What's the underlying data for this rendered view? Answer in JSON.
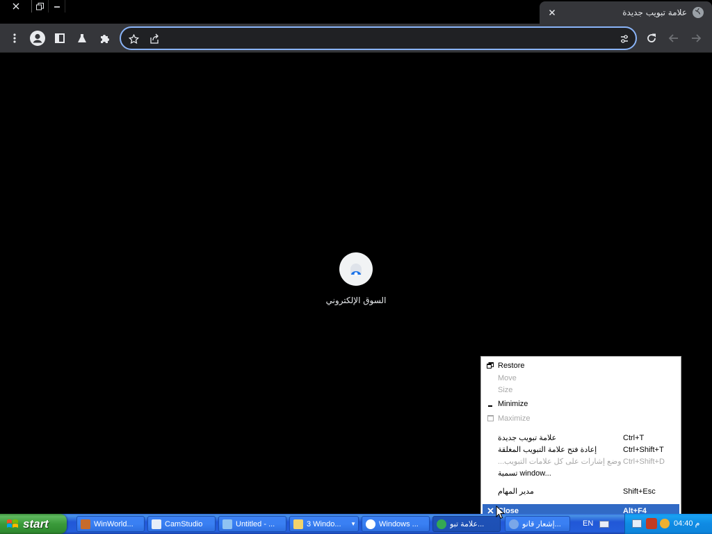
{
  "browser": {
    "tab": {
      "title": "علامة تبويب جديدة",
      "close_label": "✕"
    },
    "window_controls": {
      "close": "✕",
      "restore": "❐",
      "minimize": "—"
    },
    "omnibox": {
      "value": "",
      "placeholder": ""
    },
    "toolbar_icons": [
      "menu-dots-icon",
      "profile-icon",
      "side-panel-icon",
      "labs-flask-icon",
      "extensions-icon",
      "reload-icon",
      "back-icon",
      "forward-icon"
    ]
  },
  "content": {
    "shortcut": {
      "label": "السوق الإلكتروني"
    }
  },
  "context_menu": {
    "items": [
      {
        "label": "Restore",
        "shortcut": "",
        "enabled": true
      },
      {
        "label": "Move",
        "shortcut": "",
        "enabled": false
      },
      {
        "label": "Size",
        "shortcut": "",
        "enabled": false
      },
      {
        "label": "Minimize",
        "shortcut": "",
        "enabled": true
      },
      {
        "label": "Maximize",
        "shortcut": "",
        "enabled": false
      },
      {
        "label": "علامة تبويب جديدة",
        "shortcut": "Ctrl+T",
        "enabled": true
      },
      {
        "label": "إعادة فتح علامة التبويب المغلقة",
        "shortcut": "Ctrl+Shift+T",
        "enabled": true
      },
      {
        "label": "وضع إشارات على كل علامات التبويب...",
        "shortcut": "Ctrl+Shift+D",
        "enabled": false
      },
      {
        "label": "تسمية window...",
        "shortcut": "",
        "enabled": true
      },
      {
        "label": "مدير المهام",
        "shortcut": "Shift+Esc",
        "enabled": true
      },
      {
        "label": "Close",
        "shortcut": "Alt+F4",
        "enabled": true,
        "selected": true
      }
    ]
  },
  "taskbar": {
    "start_label": "start",
    "tasks": [
      {
        "label": "WinWorld...",
        "active": false
      },
      {
        "label": "CamStudio",
        "active": false
      },
      {
        "label": "Untitled - ...",
        "active": false
      },
      {
        "label": "3 Windo...",
        "active": false
      },
      {
        "label": "Windows ...",
        "active": false
      },
      {
        "label": "علامة تبو...",
        "active": true
      },
      {
        "label": "إشعار قانو...",
        "active": false
      }
    ],
    "language": "EN",
    "clock": "04:40 م"
  },
  "colors": {
    "tab_bg": "#35363a",
    "toolbar_bg": "#35363a",
    "omnibox_border": "#8ab4f8",
    "menu_highlight": "#316ac5",
    "taskbar_blue": "#245edb",
    "start_green": "#3a9a3a"
  }
}
